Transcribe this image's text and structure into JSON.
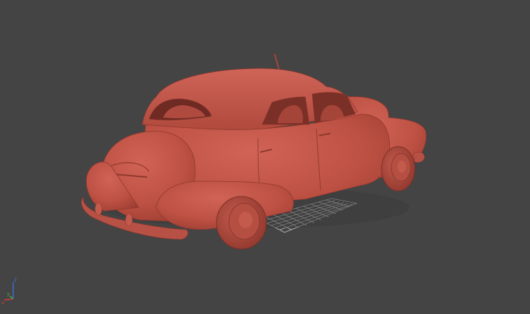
{
  "viewport": {
    "background_color": "#444444",
    "model_color": "#c4574a",
    "grid_color": "#d8d8d8"
  },
  "axis_gizmo": {
    "z_label": "z",
    "x_label": "x",
    "y_label": "y",
    "x_color": "#d23a3a",
    "y_color": "#3fae3f",
    "z_color": "#3a6fd8"
  }
}
